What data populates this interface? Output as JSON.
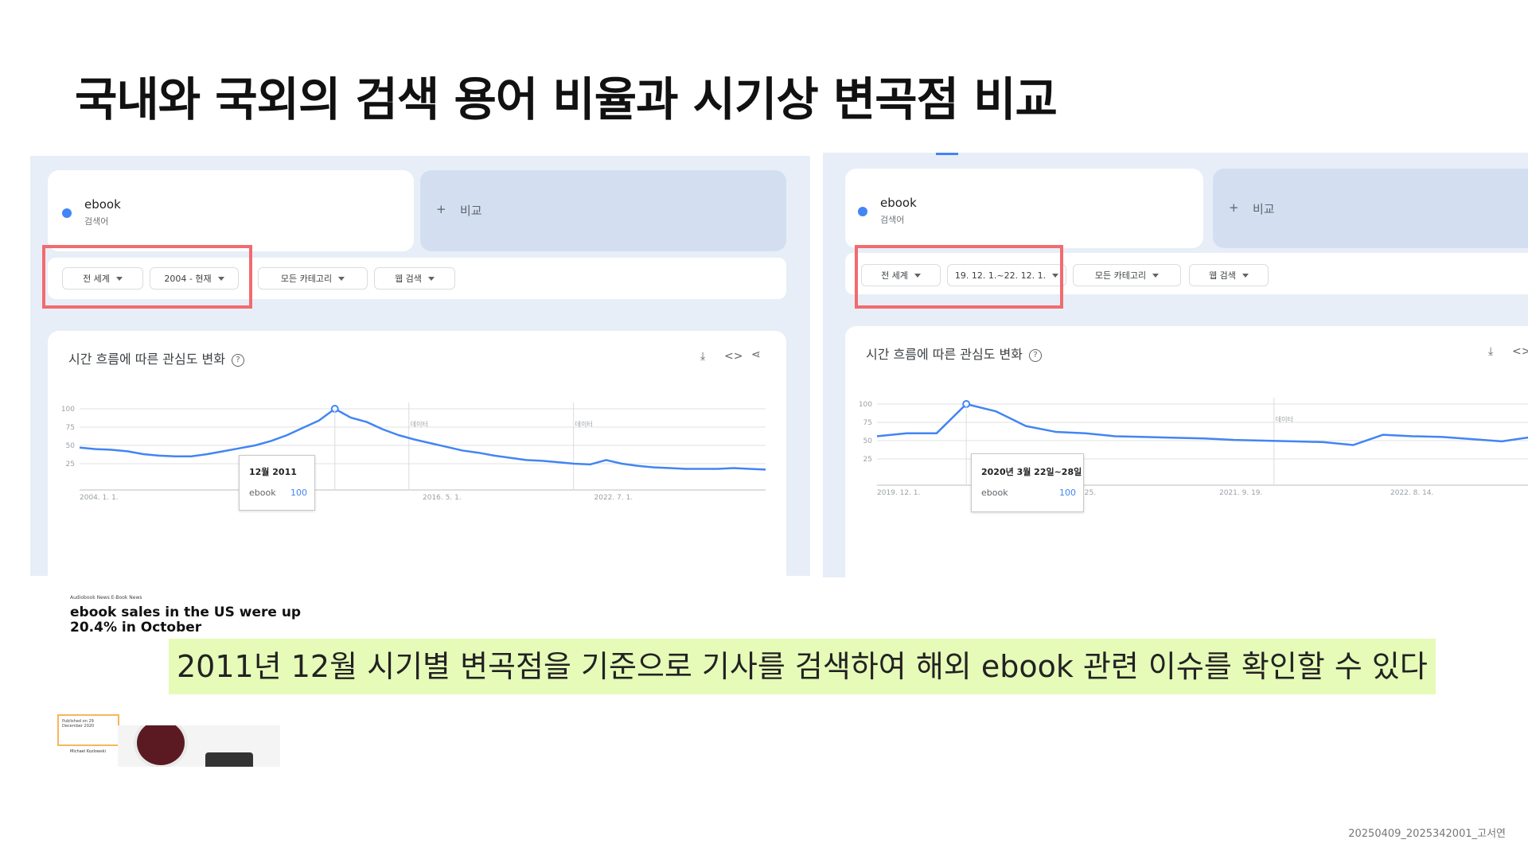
{
  "slide": {
    "title": "국내와 국외의 검색 용어 비율과 시기상 변곡점 비교",
    "highlight": "2011년 12월 시기별 변곡점을 기준으로 기사를 검색하여 해외 ebook 관련 이슈를 확인할 수 있다",
    "footer": "20250409_2025342001_고서연"
  },
  "left": {
    "term": "ebook",
    "term_sub": "검색어",
    "compare": "비교",
    "filters": {
      "region": "전 세계",
      "period": "2004 - 현재",
      "category": "모든 카테고리",
      "search_type": "웹 검색"
    },
    "chart_title": "시간 흐름에 따른 관심도 변화",
    "tooltip": {
      "date": "12월 2011",
      "term": "ebook",
      "value": "100"
    },
    "y_ticks": [
      "100",
      "75",
      "50",
      "25"
    ],
    "x_ticks": [
      "2004. 1. 1.",
      "2010. 3. 1.",
      "2016. 5. 1.",
      "2022. 7. 1."
    ],
    "note_marks": [
      "데이터",
      "데이터"
    ]
  },
  "right": {
    "term": "ebook",
    "term_sub": "검색어",
    "compare": "비교",
    "filters": {
      "region": "전 세계",
      "period": "19. 12. 1.~22. 12. 1.",
      "category": "모든 카테고리",
      "search_type": "웹 검색"
    },
    "chart_title": "시간 흐름에 따른 관심도 변화",
    "tooltip": {
      "date": "2020년 3월 22일~28일",
      "term": "ebook",
      "value": "100"
    },
    "y_ticks": [
      "100",
      "75",
      "50",
      "25"
    ],
    "x_ticks": [
      "2019. 12. 1.",
      "2020. 10. 25.",
      "2021. 9. 19.",
      "2022. 8. 14."
    ],
    "note_marks": [
      "데이터"
    ]
  },
  "news": {
    "meta": "Audiobook News   E-Book News",
    "headline": "ebook sales in the US were up 20.4% in October",
    "byline": "Published on 29 December 2020",
    "author": "Michael Kozlowski"
  },
  "colors": {
    "series": "#4285f4",
    "panel": "#e8eef7",
    "highlight": "#e6fbb8",
    "redbox": "#f16b6f"
  },
  "chart_data": [
    {
      "type": "line",
      "title": "시간 흐름에 따른 관심도 변화",
      "xlabel": "",
      "ylabel": "",
      "ylim": [
        0,
        100
      ],
      "x": [
        "2004-01",
        "2004-07",
        "2005-01",
        "2005-07",
        "2006-01",
        "2006-07",
        "2007-01",
        "2007-07",
        "2008-01",
        "2008-07",
        "2009-01",
        "2009-07",
        "2010-01",
        "2010-07",
        "2011-01",
        "2011-07",
        "2011-12",
        "2012-07",
        "2013-01",
        "2013-07",
        "2014-01",
        "2014-07",
        "2015-01",
        "2015-07",
        "2016-01",
        "2016-07",
        "2017-01",
        "2017-07",
        "2018-01",
        "2018-07",
        "2019-01",
        "2019-07",
        "2020-01",
        "2020-04",
        "2020-07",
        "2021-01",
        "2021-07",
        "2022-01",
        "2022-07",
        "2023-01",
        "2023-07",
        "2024-01",
        "2024-07",
        "2025-01"
      ],
      "series": [
        {
          "values": [
            47,
            45,
            44,
            42,
            38,
            36,
            35,
            35,
            38,
            42,
            46,
            50,
            56,
            64,
            74,
            84,
            100,
            88,
            82,
            72,
            64,
            58,
            53,
            48,
            43,
            40,
            36,
            33,
            30,
            29,
            27,
            25,
            24,
            30,
            25,
            22,
            20,
            19,
            18,
            18,
            18,
            19,
            18,
            17
          ]
        }
      ],
      "x_ticks": [
        "2004. 1. 1.",
        "2010. 3. 1.",
        "2016. 5. 1.",
        "2022. 7. 1."
      ],
      "y_ticks": [
        100,
        75,
        50,
        25
      ],
      "grid": true
    },
    {
      "type": "line",
      "title": "시간 흐름에 따른 관심도 변화",
      "xlabel": "",
      "ylabel": "",
      "ylim": [
        0,
        100
      ],
      "x": [
        "2019-12",
        "2020-01",
        "2020-02",
        "2020-03",
        "2020-04",
        "2020-05",
        "2020-06",
        "2020-07",
        "2020-09",
        "2020-11",
        "2021-01",
        "2021-03",
        "2021-05",
        "2021-07",
        "2021-09",
        "2021-11",
        "2021-12",
        "2022-01",
        "2022-03",
        "2022-05",
        "2022-07",
        "2022-09",
        "2022-11",
        "2022-12"
      ],
      "series": [
        {
          "values": [
            56,
            60,
            60,
            100,
            90,
            70,
            62,
            60,
            56,
            55,
            54,
            53,
            51,
            50,
            49,
            48,
            44,
            58,
            56,
            55,
            52,
            49,
            55,
            52
          ]
        }
      ],
      "x_ticks": [
        "2019. 12. 1.",
        "2020. 10. 25.",
        "2021. 9. 19.",
        "2022. 8. 14."
      ],
      "y_ticks": [
        100,
        75,
        50,
        25
      ],
      "grid": true
    }
  ]
}
